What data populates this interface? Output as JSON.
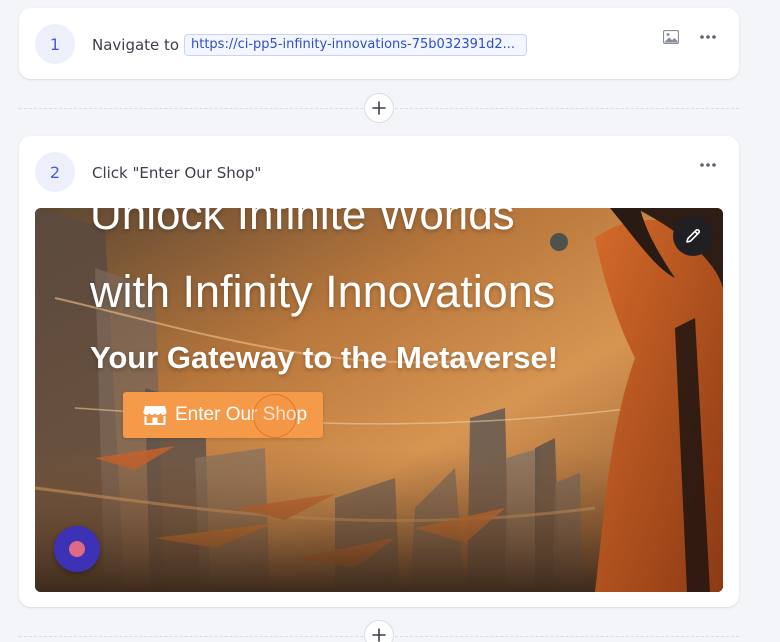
{
  "steps": [
    {
      "number": "1",
      "action": "Navigate to",
      "url": "https://ci-pp5-infinity-innovations-75b032391d2..."
    },
    {
      "number": "2",
      "action": "Click \"Enter Our Shop\"",
      "screenshot": {
        "hero_line_1": "Unlock Infinite Worlds",
        "hero_line_2": "with Infinity Innovations",
        "hero_line_3": "Your Gateway to the Metaverse!",
        "button_label": "Enter Our Shop"
      }
    }
  ],
  "icons": {
    "image": "image-icon",
    "more": "more-horizontal-icon",
    "add": "plus-icon",
    "edit": "pencil-icon",
    "store": "store-icon",
    "record": "record-icon"
  },
  "colors": {
    "accent": "#4b5bd8",
    "url_text": "#2d4fc7",
    "shop_button": "#f59a49",
    "record_button": "#3d32b5"
  }
}
